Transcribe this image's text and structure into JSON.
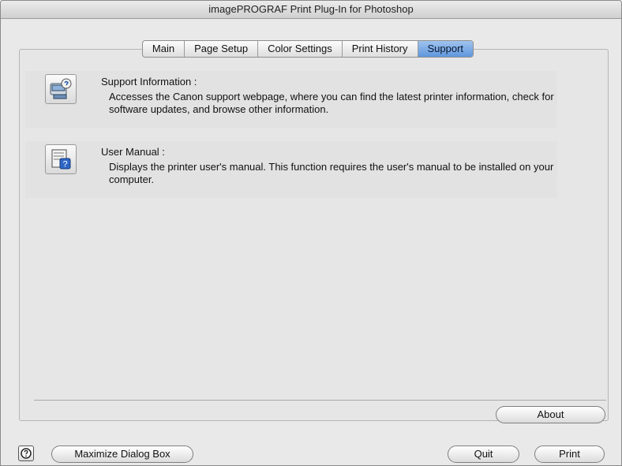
{
  "window": {
    "title": "imagePROGRAF Print Plug-In for Photoshop"
  },
  "tabs": [
    {
      "label": "Main",
      "active": false
    },
    {
      "label": "Page Setup",
      "active": false
    },
    {
      "label": "Color Settings",
      "active": false
    },
    {
      "label": "Print History",
      "active": false
    },
    {
      "label": "Support",
      "active": true
    }
  ],
  "support": {
    "info_title": "Support Information :",
    "info_desc": "Accesses the Canon support webpage, where you can find the latest printer information, check for software updates, and browse other information.",
    "info_icon": "support-info-icon",
    "manual_title": "User Manual :",
    "manual_desc": "Displays the printer user's manual. This function requires the user's manual to be installed on your computer.",
    "manual_icon": "user-manual-icon"
  },
  "buttons": {
    "about": "About",
    "maximize": "Maximize Dialog Box",
    "quit": "Quit",
    "print": "Print"
  },
  "colors": {
    "active_tab": "#6ea3e2"
  }
}
